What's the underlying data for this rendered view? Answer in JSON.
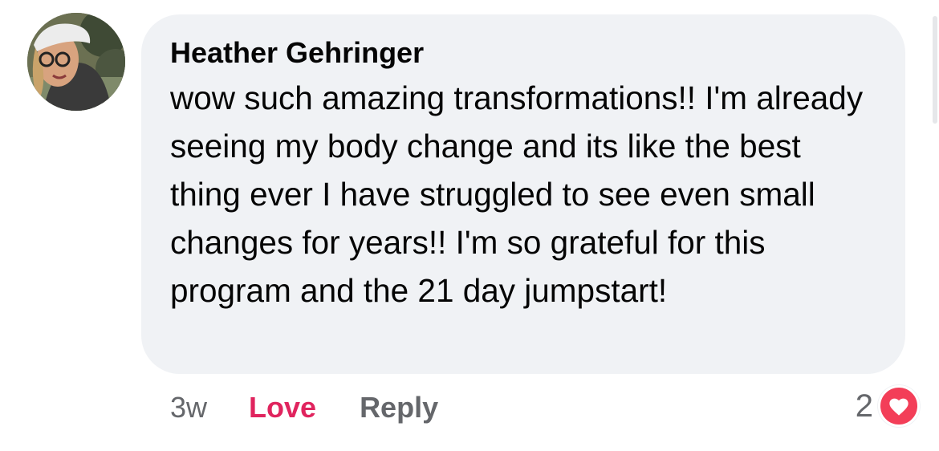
{
  "comment": {
    "author": "Heather Gehringer",
    "text": "wow such amazing transformations!! I'm already seeing my body change and its like the best thing ever I have struggled to see even small changes for years!! I'm so grateful for this program and the 21 day jumpstart!",
    "time": "3w",
    "love_label": "Love",
    "reply_label": "Reply",
    "reaction_count": "2",
    "reaction_icon": "heart-icon"
  },
  "colors": {
    "bubble": "#f0f2f5",
    "love": "#e0245e",
    "heart_badge": "#f33e58",
    "secondary_text": "#65676b"
  }
}
